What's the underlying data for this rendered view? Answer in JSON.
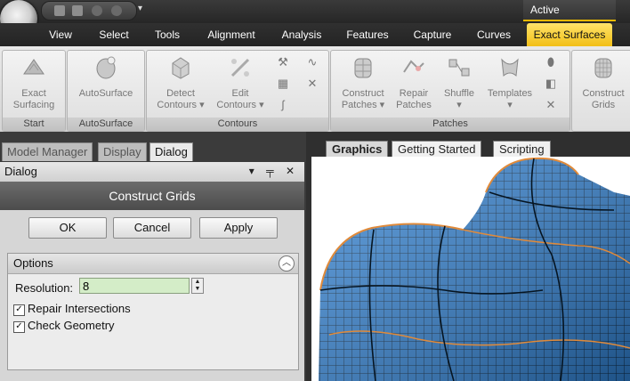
{
  "app": {
    "status": "Active",
    "colors": {
      "accent": "#f2bf16",
      "surface": "#2f7fd0",
      "grid_lines": "#0b2742",
      "edge": "#e08a3a"
    }
  },
  "quick_access": {
    "icons": [
      "folder-icon",
      "save-icon",
      "undo-icon",
      "redo-icon"
    ],
    "more": "▾"
  },
  "menu_tabs": [
    "View",
    "Select",
    "Tools",
    "Alignment",
    "Analysis",
    "Features",
    "Capture",
    "Curves",
    "Exact Surfaces"
  ],
  "active_tab": "Exact Surfaces",
  "ribbon": {
    "groups": [
      {
        "label": "Start",
        "buttons": [
          {
            "label1": "Exact",
            "label2": "Surfacing"
          }
        ]
      },
      {
        "label": "AutoSurface",
        "buttons": [
          {
            "label1": "AutoSurface",
            "label2": ""
          }
        ]
      },
      {
        "label": "Contours",
        "buttons": [
          {
            "label1": "Detect",
            "label2": "Contours ▾"
          },
          {
            "label1": "Edit",
            "label2": "Contours ▾"
          }
        ]
      },
      {
        "label": "Patches",
        "buttons": [
          {
            "label1": "Construct",
            "label2": "Patches ▾"
          },
          {
            "label1": "Repair",
            "label2": "Patches"
          },
          {
            "label1": "Shuffle",
            "label2": "▾"
          },
          {
            "label1": "Templates",
            "label2": "▾"
          }
        ]
      },
      {
        "label": "",
        "buttons": [
          {
            "label1": "Construct",
            "label2": "Grids"
          }
        ]
      }
    ]
  },
  "left_panel": {
    "tabs": [
      "Model Manager",
      "Display",
      "Dialog"
    ],
    "dialog_header": "Dialog",
    "dialog_controls": "▾ ╤ ✕",
    "title": "Construct Grids",
    "buttons": {
      "ok": "OK",
      "cancel": "Cancel",
      "apply": "Apply"
    },
    "options": {
      "title": "Options",
      "resolution_label": "Resolution:",
      "resolution_value": "8",
      "repair_label": "Repair Intersections",
      "repair_checked": true,
      "check_label": "Check Geometry",
      "check_checked": true
    }
  },
  "graphics": {
    "tabs": [
      "Graphics",
      "Getting Started",
      "Scripting"
    ]
  }
}
